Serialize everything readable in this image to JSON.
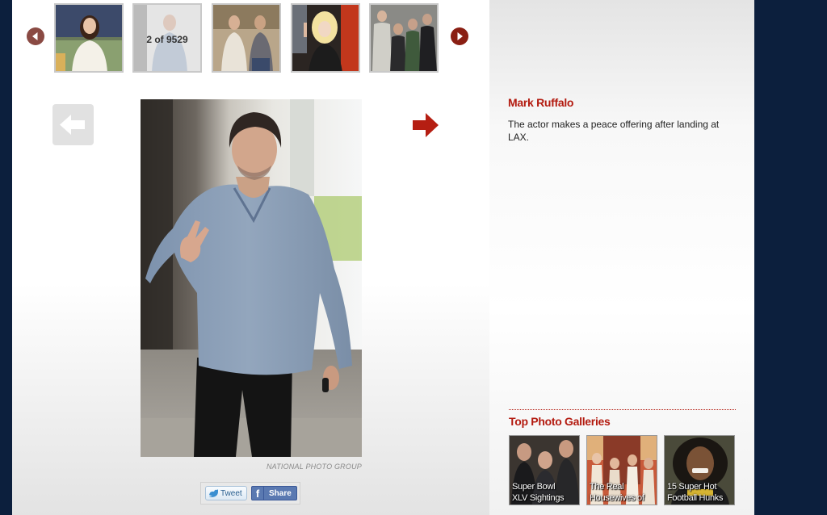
{
  "carousel": {
    "counter": "2 of 9529",
    "prev_icon": "chevron-left-icon",
    "next_icon": "chevron-right-icon",
    "thumbnails": [
      "thumb-1",
      "thumb-2",
      "thumb-3",
      "thumb-4",
      "thumb-5"
    ]
  },
  "photo": {
    "credit": "NATIONAL PHOTO GROUP",
    "prev_icon": "arrow-left-icon",
    "next_icon": "arrow-right-icon"
  },
  "share": {
    "tweet_label": "Tweet",
    "share_label": "Share"
  },
  "caption": {
    "title": "Mark Ruffalo",
    "text": "The actor makes a peace offering after landing at LAX."
  },
  "galleries": {
    "heading": "Top Photo Galleries",
    "items": [
      {
        "label": "Super Bowl\nXLV Sightings"
      },
      {
        "label": "The Real\nHousewives of"
      },
      {
        "label": "15 Super Hot\nFootball Hunks"
      }
    ]
  },
  "colors": {
    "accent_red": "#b31a0f",
    "page_background": "#0c1f3d",
    "round_button": "#8c2a1f"
  }
}
